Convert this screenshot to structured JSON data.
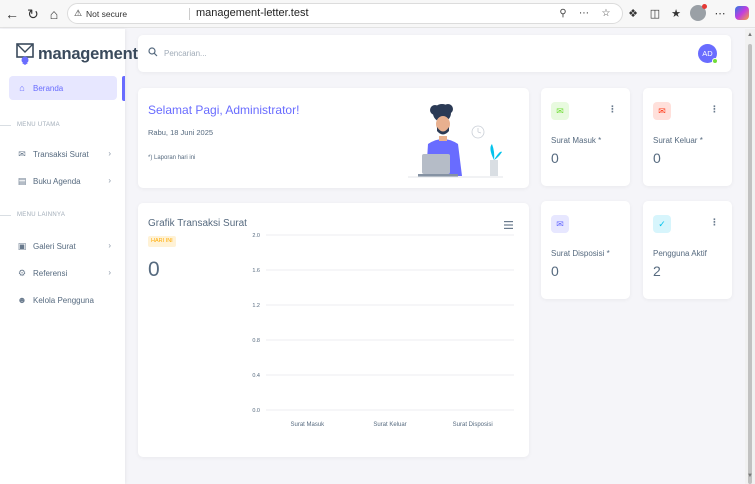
{
  "browser": {
    "security_label": "Not secure",
    "url": "management-letter.test"
  },
  "brand": {
    "name": "management"
  },
  "sidebar": {
    "items": [
      {
        "label": "Beranda",
        "icon": "home-icon",
        "active": true
      },
      {
        "header": "MENU UTAMA"
      },
      {
        "label": "Transaksi Surat",
        "icon": "mail-icon",
        "has_children": true
      },
      {
        "label": "Buku Agenda",
        "icon": "book-icon",
        "has_children": true
      },
      {
        "header": "MENU LAINNYA"
      },
      {
        "label": "Galeri Surat",
        "icon": "gallery-icon",
        "has_children": true
      },
      {
        "label": "Referensi",
        "icon": "settings-icon",
        "has_children": true
      },
      {
        "label": "Kelola Pengguna",
        "icon": "user-icon",
        "has_children": false
      }
    ]
  },
  "topbar": {
    "search_placeholder": "Pencarian...",
    "avatar_initials": "AD"
  },
  "welcome": {
    "title": "Selamat Pagi, Administrator!",
    "date": "Rabu, 18 Juni 2025",
    "note": "*) Laporan hari ini"
  },
  "chart_card": {
    "title": "Grafik Transaksi Surat",
    "badge": "HARI INI",
    "total": "0"
  },
  "chart_data": {
    "type": "bar",
    "categories": [
      "Surat Masuk",
      "Surat Keluar",
      "Surat Disposisi"
    ],
    "values": [
      0,
      0,
      0
    ],
    "ylim": [
      0,
      2
    ],
    "yticks": [
      "0.0",
      "0.4",
      "0.8",
      "1.2",
      "1.6",
      "2.0"
    ],
    "grid": true,
    "title": "",
    "xlabel": "",
    "ylabel": ""
  },
  "stats": [
    {
      "label": "Surat Masuk *",
      "value": "0",
      "icon": "mail-in-icon",
      "color": "#71dd37",
      "bg": "#e8fadf"
    },
    {
      "label": "Surat Keluar *",
      "value": "0",
      "icon": "mail-out-icon",
      "color": "#ff3e1d",
      "bg": "#ffe0db"
    },
    {
      "label": "Surat Disposisi *",
      "value": "0",
      "icon": "mail-disposition-icon",
      "color": "#696cff",
      "bg": "#e7e7ff"
    },
    {
      "label": "Pengguna Aktif",
      "value": "2",
      "icon": "user-check-icon",
      "color": "#03c3ec",
      "bg": "#d7f5fc"
    }
  ],
  "colors": {
    "primary": "#696cff",
    "text": "#566a7f",
    "warning": "#ffab00"
  }
}
